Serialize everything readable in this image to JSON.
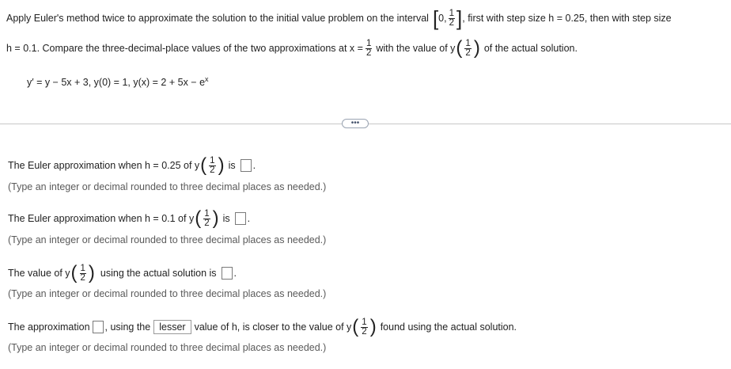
{
  "problem": {
    "intro": "Apply Euler's method twice to approximate the solution to the initial value problem on the interval",
    "interval_start": "0,",
    "half_num": "1",
    "half_den": "2",
    "intro_after": ", first with step size h = 0.25, then with step size",
    "line2_start": "h = 0.1. Compare the three-decimal-place values of the two approximations at x =",
    "line2_mid": "with the value of y",
    "line2_end": "of the actual solution.",
    "equation": "y′ = y − 5x + 3, y(0) = 1, y(x) = 2 + 5x − e",
    "equation_exp": "x"
  },
  "more_button": "•••",
  "questions": {
    "q1_text": "The Euler approximation when h = 0.25 of y",
    "q1_is": "is",
    "q1_hint": "(Type an integer or decimal rounded to three decimal places as needed.)",
    "q2_text": "The Euler approximation when h = 0.1 of y",
    "q2_is": "is",
    "q2_hint": "(Type an integer or decimal rounded to three decimal places as needed.)",
    "q3_text": "The value of y",
    "q3_after": "using the actual solution is",
    "q3_hint": "(Type an integer or decimal rounded to three decimal places as needed.)",
    "q4_text": "The approximation",
    "q4_mid": ", using the",
    "q4_dropdown": "lesser",
    "q4_after": "value of h, is closer to the value of y",
    "q4_end": "found using the actual solution.",
    "q4_hint": "(Type an integer or decimal rounded to three decimal places as needed.)"
  }
}
